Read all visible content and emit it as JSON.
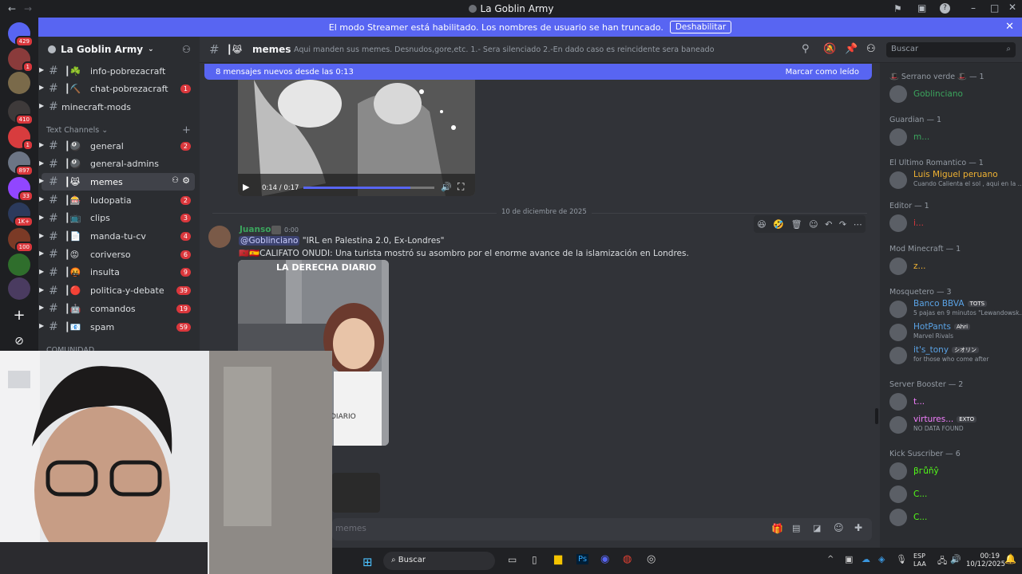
{
  "window": {
    "title": "La Goblin Army"
  },
  "banner": {
    "text": "El modo Streamer está habilitado. Los nombres de usuario se han truncado.",
    "button": "Deshabilitar"
  },
  "server_list": {
    "badges": [
      "429",
      "1",
      "410",
      "1",
      "897",
      "33",
      "1K+",
      "100"
    ]
  },
  "server": {
    "name": "La Goblin Army"
  },
  "channels": [
    {
      "name": "info-pobrezacraft",
      "prefix": "┃☘️",
      "count": ""
    },
    {
      "name": "chat-pobrezacraft",
      "prefix": "┃⛏️",
      "count": "1"
    },
    {
      "name": "minecraft-mods",
      "prefix": "",
      "count": ""
    }
  ],
  "category": "Text Channels",
  "text_channels": [
    {
      "name": "general",
      "prefix": "┃🎱",
      "count": "2"
    },
    {
      "name": "general-admins",
      "prefix": "┃🎱",
      "count": ""
    },
    {
      "name": "memes",
      "prefix": "┃😹",
      "count": ""
    },
    {
      "name": "ludopatia",
      "prefix": "┃🎰",
      "count": "2"
    },
    {
      "name": "clips",
      "prefix": "┃📺",
      "count": "3"
    },
    {
      "name": "manda-tu-cv",
      "prefix": "┃📄",
      "count": "4"
    },
    {
      "name": "coriverso",
      "prefix": "┃😡",
      "count": "6"
    },
    {
      "name": "insulta",
      "prefix": "┃🤬",
      "count": "9"
    },
    {
      "name": "politica-y-debate",
      "prefix": "┃🔴",
      "count": "39"
    },
    {
      "name": "comandos",
      "prefix": "┃🤖",
      "count": "19"
    },
    {
      "name": "spam",
      "prefix": "┃📧",
      "count": "59"
    }
  ],
  "category2": "COMUNIDAD",
  "channel_header": {
    "name": "memes",
    "prefix": "┃😹",
    "topic": "Aqui manden sus memes. Desnudos,gore,etc. 1.- Sera silenciado 2.-En dado caso es reincidente sera baneado",
    "search_placeholder": "Buscar"
  },
  "new_messages": {
    "text": "8 mensajes nuevos desde las 0:13",
    "action": "Marcar como leído"
  },
  "video": {
    "time": "0:14 / 0:17",
    "progress": 0.82
  },
  "date_divider": "10 de diciembre de 2025",
  "message": {
    "author": "Juanson",
    "time": "0:00",
    "mention": "@Goblinciano",
    "line1": " \"IRL en Palestina 2.0, Ex-Londres\"",
    "line2": "CALIFATO ONUDI: Una turista mostró su asombro por el enorme avance de la islamización en Londres.",
    "image_caption": "LA DERECHA DIARIO",
    "image_caption2": "DIARIO"
  },
  "composer": {
    "placeholder": "memes"
  },
  "members": {
    "groups": [
      {
        "title": "🎩 Serrano verde 🎩 — 1",
        "members": [
          {
            "name": "Goblinciano",
            "sub": "",
            "color": "#3ba55d"
          }
        ]
      },
      {
        "title": "Guardian — 1",
        "members": [
          {
            "name": "m...",
            "sub": "",
            "color": "#3ba55d"
          }
        ]
      },
      {
        "title": "El Ultimo Romantico — 1",
        "members": [
          {
            "name": "Luis Miguel peruano",
            "sub": "Cuando Calienta el sol , aqui en la ...",
            "color": "#f0b232"
          }
        ]
      },
      {
        "title": "Editor — 1",
        "members": [
          {
            "name": "i...",
            "sub": "",
            "color": "#da373c"
          }
        ]
      },
      {
        "title": "Mod Minecraft — 1",
        "members": [
          {
            "name": "z...",
            "sub": "",
            "color": "#f0b232"
          }
        ]
      },
      {
        "title": "Mosquetero — 3",
        "members": [
          {
            "name": "Banco BBVA",
            "tag": "TOTS",
            "sub": "5 pajas en 9 minutos \"Lewandowsk...",
            "color": "#5aa3e6"
          },
          {
            "name": "HotPants",
            "tag": "Ahri",
            "sub": "Marvel Rivals",
            "color": "#5aa3e6"
          },
          {
            "name": "it's_tony",
            "tag": "シオリン",
            "sub": "for those who come after",
            "color": "#5aa3e6"
          }
        ]
      },
      {
        "title": "Server Booster — 2",
        "members": [
          {
            "name": "t...",
            "sub": "",
            "color": "#f47fff"
          },
          {
            "name": "virtures...",
            "tag": "EXTO",
            "sub": "NO DATA FOUND",
            "color": "#f47fff"
          }
        ]
      },
      {
        "title": "Kick Suscriber — 6",
        "members": [
          {
            "name": "βгůňŷ",
            "sub": "",
            "color": "#53fc18"
          },
          {
            "name": "C...",
            "sub": "",
            "color": "#53fc18"
          },
          {
            "name": "C...",
            "sub": "",
            "color": "#53fc18"
          }
        ]
      }
    ]
  },
  "taskbar": {
    "search": "Buscar",
    "lang1": "ESP",
    "lang2": "LAA",
    "time": "00:19",
    "date": "10/12/2025"
  },
  "colors": {
    "accent": "#5865f2",
    "badge": "#da373c"
  }
}
